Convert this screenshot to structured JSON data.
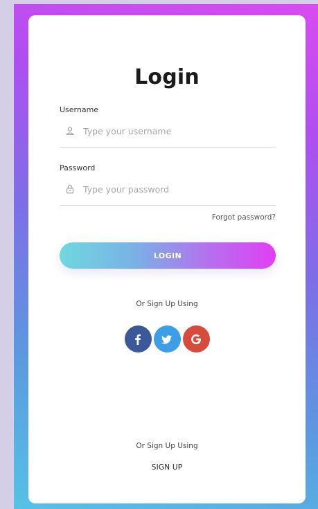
{
  "form": {
    "title": "Login",
    "username": {
      "label": "Username",
      "placeholder": "Type your username",
      "value": ""
    },
    "password": {
      "label": "Password",
      "placeholder": "Type your password",
      "value": ""
    },
    "forgot_label": "Forgot password?",
    "login_label": "LOGIN",
    "social_prompt": "Or Sign Up Using",
    "social": [
      {
        "name": "facebook",
        "icon": "facebook-icon",
        "color": "#3b5998"
      },
      {
        "name": "twitter",
        "icon": "twitter-icon",
        "color": "#3d9ee8"
      },
      {
        "name": "google",
        "icon": "google-icon",
        "color": "#d64b3c"
      }
    ],
    "signup_prompt": "Or Sign Up Using",
    "signup_label": "SIGN UP"
  },
  "colors": {
    "gradient_start": "#6fd8df",
    "gradient_end": "#e23ef4",
    "background_top": "#d94cf0",
    "background_bottom": "#56c2e6"
  }
}
